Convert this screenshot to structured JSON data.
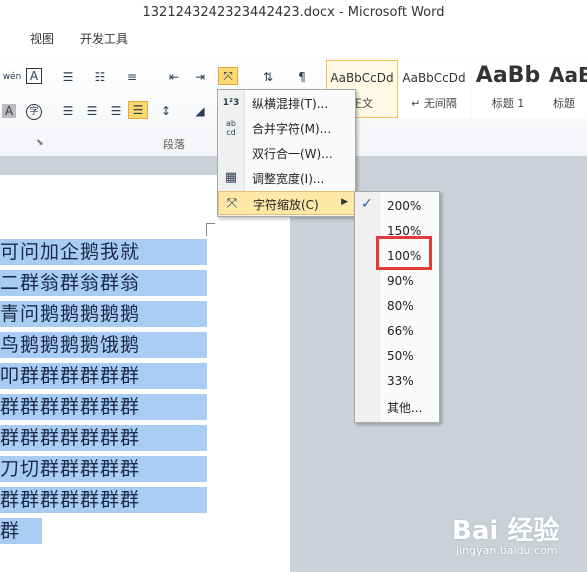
{
  "window": {
    "title": "1321243242323442423.docx - Microsoft Word"
  },
  "tabs": [
    {
      "label": "视图"
    },
    {
      "label": "开发工具"
    }
  ],
  "ribbon": {
    "paragraph_group_label": "段落",
    "styles": [
      {
        "preview": "AaBbCcDd",
        "name": "正文",
        "selected": true
      },
      {
        "preview": "AaBbCcDd",
        "name": "↵ 无间隔",
        "selected": false
      },
      {
        "preview": "AaBb",
        "name": "标题 1",
        "selected": false
      },
      {
        "preview": "AaBb",
        "name": "标题",
        "selected": false
      }
    ]
  },
  "dropdown_menu": {
    "items": [
      {
        "label": "纵横混排(T)...",
        "icon": "horizontal-in-vertical-icon"
      },
      {
        "label": "合并字符(M)...",
        "icon": "combine-characters-icon"
      },
      {
        "label": "双行合一(W)...",
        "icon": "two-lines-in-one-icon"
      },
      {
        "label": "调整宽度(I)...",
        "icon": "fit-text-icon"
      },
      {
        "label": "字符缩放(C)",
        "icon": "character-scale-icon",
        "highlighted": true,
        "has_submenu": true
      }
    ]
  },
  "scale_submenu": {
    "items": [
      {
        "label": "200%",
        "checked": true
      },
      {
        "label": "150%"
      },
      {
        "label": "100%",
        "annotated": true
      },
      {
        "label": "90%"
      },
      {
        "label": "80%"
      },
      {
        "label": "66%"
      },
      {
        "label": "50%"
      },
      {
        "label": "33%"
      },
      {
        "label": "其他..."
      }
    ]
  },
  "document": {
    "lines": [
      "可问加企鹅我就",
      "二群翁群翁群翁",
      "青问鹅鹅鹅鹅鹅",
      "鸟鹅鹅鹅鹅饿鹅",
      "叩群群群群群群",
      "群群群群群群群",
      "群群群群群群群",
      "刀切群群群群群",
      "群群群群群群群",
      "群"
    ]
  },
  "watermark": {
    "logo": "Bai 经验",
    "url": "jingyan.baidu.com"
  },
  "colors": {
    "selection": "#a9cdf2",
    "menu_highlight": "#fde8a8",
    "annotation_red": "#e23b3b",
    "accent_blue": "#2a5db0"
  }
}
